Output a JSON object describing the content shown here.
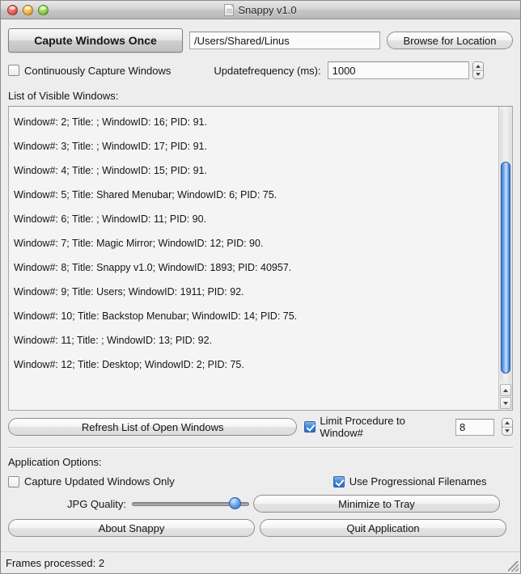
{
  "window": {
    "title": "Snappy v1.0",
    "title_icon": "document-icon",
    "traffic_lights": [
      {
        "name": "close-button",
        "color": "#e8564a"
      },
      {
        "name": "minimize-button",
        "color": "#efb13c"
      },
      {
        "name": "zoom-button",
        "color": "#84c93f"
      }
    ]
  },
  "toolbar": {
    "capture_once_label": "Capute Windows Once",
    "path_value": "/Users/Shared/Linus",
    "path_placeholder": "/Users/Shared/Linus",
    "browse_label": "Browse for Location"
  },
  "options_top": {
    "continuous_label": "Continuously Capture Windows",
    "continuous_checked": false,
    "frequency_label": "Updatefrequency (ms):",
    "frequency_value": "1000",
    "frequency_stepper": "stepper-icon"
  },
  "list": {
    "label": "List of Visible Windows:",
    "items": [
      "Window#: 2; Title: ; WindowID: 16; PID: 91.",
      "Window#: 3; Title: ; WindowID: 17; PID: 91.",
      "Window#: 4; Title: ; WindowID: 15; PID: 91.",
      "Window#: 5; Title: Shared Menubar; WindowID: 6; PID: 75.",
      "Window#: 6; Title: ; WindowID: 11; PID: 90.",
      "Window#: 7; Title: Magic Mirror; WindowID: 12; PID: 90.",
      "Window#: 8; Title: Snappy v1.0; WindowID: 1893; PID: 40957.",
      "Window#: 9; Title: Users; WindowID: 1911; PID: 92.",
      "Window#: 10; Title: Backstop Menubar; WindowID: 14; PID: 75.",
      "Window#: 11; Title: ; WindowID: 13; PID: 92.",
      "Window#: 12; Title: Desktop; WindowID: 2; PID: 75."
    ],
    "scrollbar": {
      "up_arrow": "scroll-up-icon",
      "down_arrow": "scroll-down-icon",
      "thumb_color": "#3e7fd6"
    }
  },
  "refresh_row": {
    "refresh_label": "Refresh List of Open Windows",
    "limit_label": "Limit Procedure to Window#",
    "limit_checked": true,
    "limit_value": "8",
    "limit_stepper": "stepper-icon"
  },
  "app_options": {
    "section_label": "Application Options:",
    "updated_only_label": "Capture Updated Windows Only",
    "updated_only_checked": false,
    "progressional_label": "Use Progressional Filenames",
    "progressional_checked": true,
    "jpg_quality_label": "JPG Quality:",
    "jpg_quality_percent": 92,
    "minimize_label": "Minimize to Tray",
    "about_label": "About Snappy",
    "quit_label": "Quit Application"
  },
  "statusbar": {
    "text": "Frames processed: 2",
    "grip": "resize-grip-icon"
  }
}
